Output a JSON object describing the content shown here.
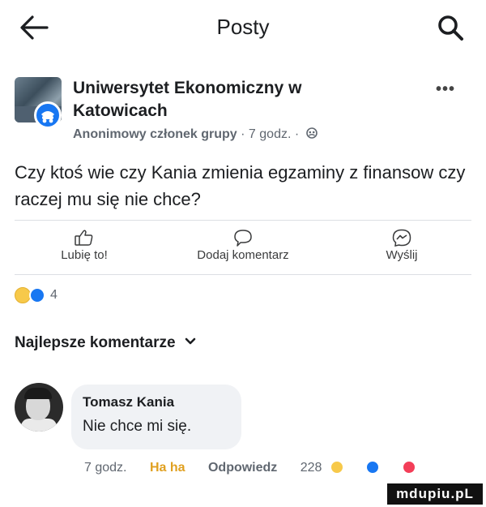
{
  "header": {
    "title": "Posty",
    "back_icon": "arrow-left-icon",
    "search_icon": "search-icon"
  },
  "post": {
    "group_name": "Uniwersytet Ekonomiczny w Katowicach",
    "author": "Anonimowy członek grupy",
    "time": "7 godz.",
    "separator": "·",
    "text": "Czy ktoś wie czy Kania zmienia egzaminy z finansow czy raczej mu się nie chce?"
  },
  "actions": {
    "like": "Lubię to!",
    "comment": "Dodaj komentarz",
    "send": "Wyślij"
  },
  "reactions": {
    "count": "4"
  },
  "best_comments": {
    "label": "Najlepsze komentarze"
  },
  "comment": {
    "author": "Tomasz Kania",
    "text": "Nie chce mi się.",
    "time": "7 godz.",
    "reaction_label": "Ha ha",
    "reply_label": "Odpowiedz",
    "reaction_count": "228"
  },
  "watermark": {
    "text": "mdupiu.pL"
  },
  "colors": {
    "accent": "#1877f2",
    "haha": "#f7c94a",
    "bubble": "#f0f2f5",
    "angry": "#f33e58"
  }
}
